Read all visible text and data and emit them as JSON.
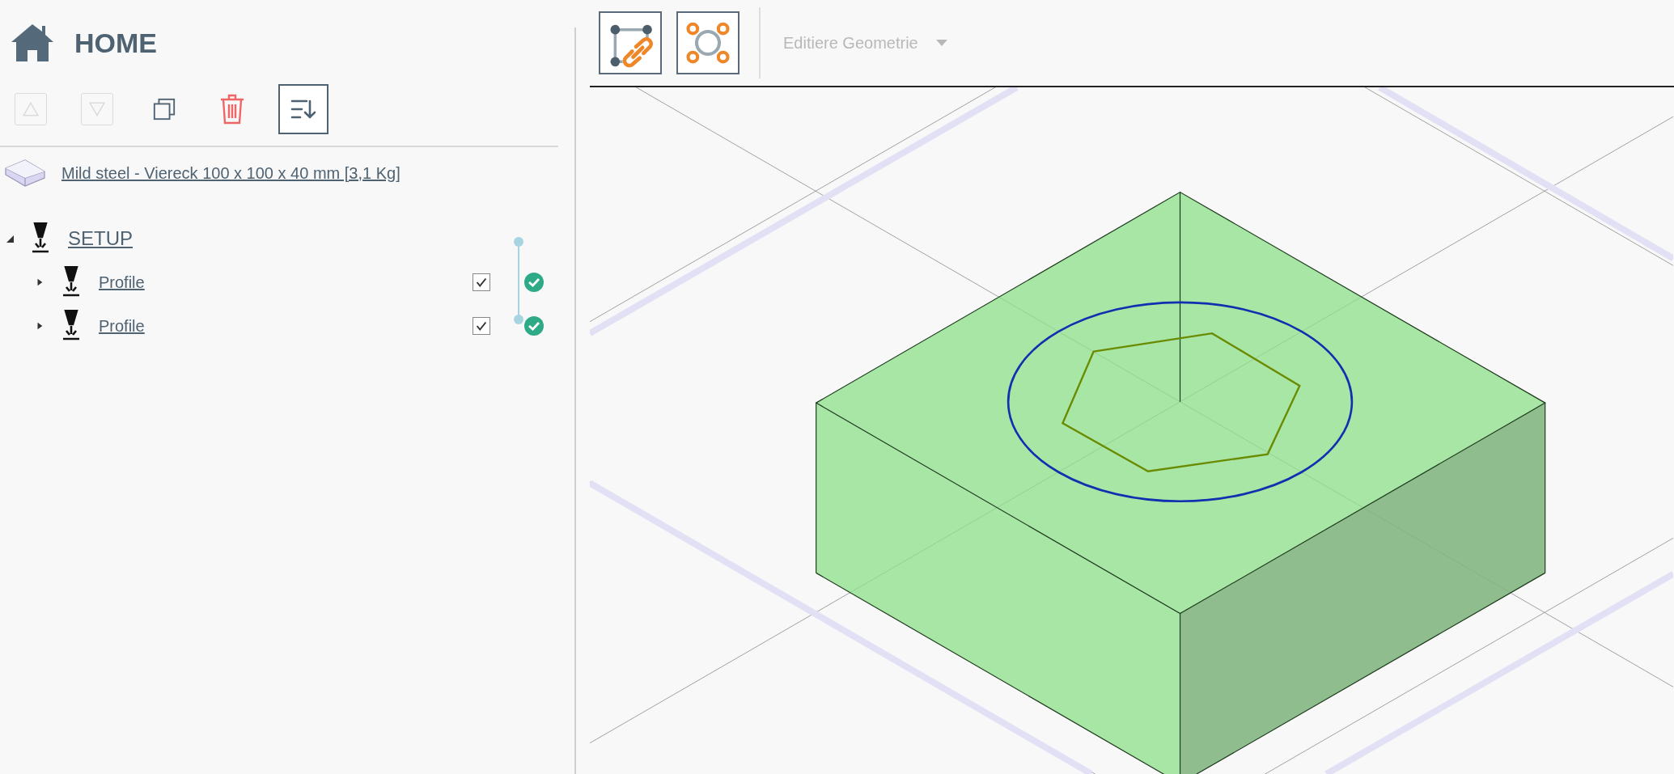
{
  "header": {
    "title": "HOME"
  },
  "toolbar": [
    {
      "kind": "up",
      "disabled": true
    },
    {
      "kind": "down",
      "disabled": true
    },
    {
      "kind": "copy",
      "disabled": false
    },
    {
      "kind": "delete",
      "disabled": false
    },
    {
      "kind": "sort",
      "disabled": false
    }
  ],
  "material": {
    "label": "Mild steel - Viereck 100 x 100 x 40 mm [3,1 Kg]"
  },
  "tree": {
    "label": "SETUP",
    "expanded": true,
    "children": [
      {
        "label": "Profile",
        "expanded": false,
        "checked": true,
        "done": true
      },
      {
        "label": "Profile",
        "expanded": false,
        "checked": true,
        "done": true
      }
    ]
  },
  "viewport_toolbar": {
    "tools": [
      {
        "kind": "link-geometry"
      },
      {
        "kind": "circle-points"
      }
    ],
    "dropdown": {
      "label": "Editiere Geometrie",
      "disabled": true
    }
  }
}
